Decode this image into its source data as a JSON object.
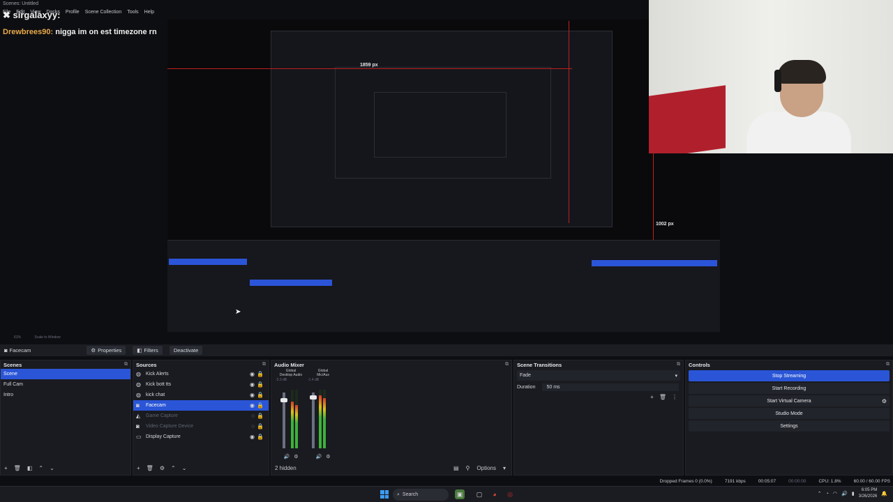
{
  "stream_overlay": {
    "window_title": "Scenes: Untitled",
    "menu": [
      "File",
      "Edit",
      "View",
      "Docks",
      "Profile",
      "Scene Collection",
      "Tools",
      "Help"
    ],
    "chat_username": "sirgalaxyy:",
    "chat_name": "Drewbrees90:",
    "chat_message": "nigga im on est timezone rn"
  },
  "preview": {
    "measure_top": "1859 px",
    "measure_right": "1002 px",
    "zoom_label": "61%",
    "scale_label": "Scale to Window"
  },
  "source_toolbar": {
    "source_name": "Facecam",
    "properties": "Properties",
    "filters": "Filters",
    "deactivate": "Deactivate"
  },
  "scenes": {
    "title": "Scenes",
    "items": [
      {
        "label": "Scene",
        "selected": true
      },
      {
        "label": "Full Cam",
        "selected": false
      },
      {
        "label": "Intro",
        "selected": false
      }
    ]
  },
  "sources": {
    "title": "Sources",
    "items": [
      {
        "label": "Kick Alerts",
        "icon": "globe-icon",
        "dim": false,
        "selected": false
      },
      {
        "label": "Kick bott tts",
        "icon": "globe-icon",
        "dim": false,
        "selected": false
      },
      {
        "label": "kick chat",
        "icon": "globe-icon",
        "dim": false,
        "selected": false
      },
      {
        "label": "Facecam",
        "icon": "camera-icon",
        "dim": false,
        "selected": true
      },
      {
        "label": "Game Capture",
        "icon": "gamepad-icon",
        "dim": true,
        "selected": false
      },
      {
        "label": "Video Capture Device",
        "icon": "camera-icon",
        "dim": true,
        "selected": false
      },
      {
        "label": "Display Capture",
        "icon": "monitor-icon",
        "dim": false,
        "selected": false
      }
    ]
  },
  "audio_mixer": {
    "title": "Audio Mixer",
    "channels": [
      {
        "tag": "Global",
        "name": "Desktop Audio",
        "db": "-3.3 dB",
        "level": 0.8
      },
      {
        "tag": "Global",
        "name": "Mic/Aux",
        "db": "-1.4 dB",
        "level": 0.9
      }
    ],
    "hidden": "2 hidden",
    "options": "Options"
  },
  "scene_transitions": {
    "title": "Scene Transitions",
    "type": "Fade",
    "duration_label": "Duration",
    "duration_value": "50 ms"
  },
  "controls": {
    "title": "Controls",
    "buttons": [
      "Stop Streaming",
      "Start Recording",
      "Start Virtual Camera",
      "Studio Mode",
      "Settings"
    ]
  },
  "status": {
    "dropped": "Dropped Frames 0 (0.0%)",
    "bitrate": "7191 kbps",
    "stream_time": "00:05:07",
    "rec_time": "00:00:00",
    "cpu": "CPU: 1.8%",
    "fps": "60.00 / 60.00 FPS"
  },
  "taskbar": {
    "search": "Search",
    "time": "6:05 PM",
    "date": "3/26/2026"
  },
  "colors": {
    "accent": "#2a55d6",
    "live_red": "#c02020",
    "chat_name": "#e8a948"
  }
}
